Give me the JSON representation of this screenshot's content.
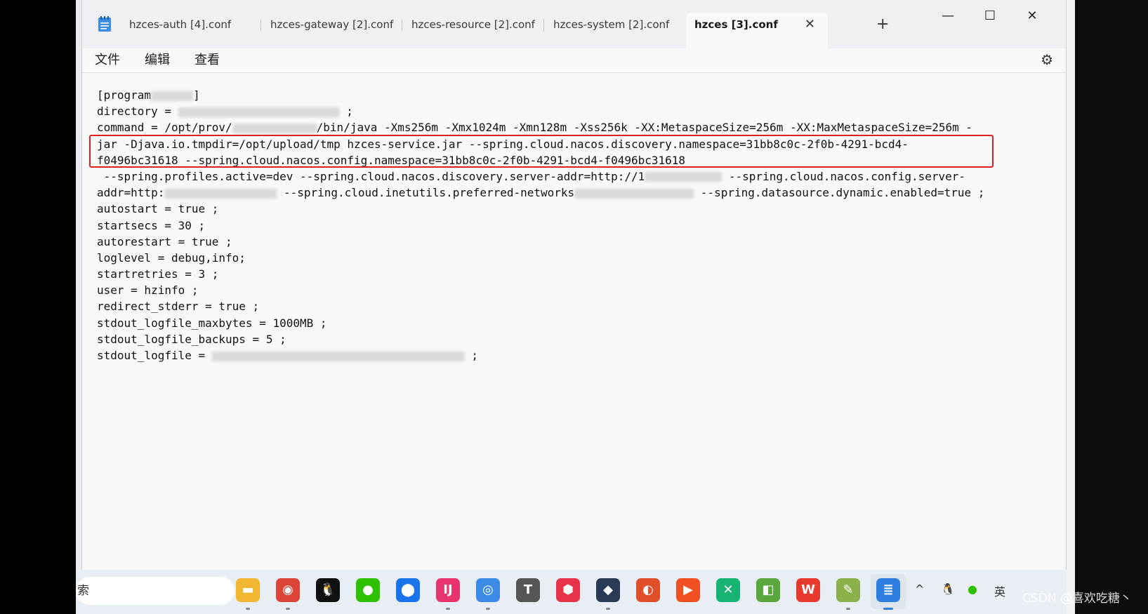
{
  "window": {
    "title_tabs": [
      {
        "label": "hzces-auth [4].conf",
        "active": false
      },
      {
        "label": "hzces-gateway [2].conf",
        "active": false
      },
      {
        "label": "hzces-resource [2].conf",
        "active": false
      },
      {
        "label": "hzces-system [2].conf",
        "active": false
      },
      {
        "label": "hzces [3].conf",
        "active": true
      }
    ],
    "close_tab_glyph": "✕",
    "new_tab_glyph": "+",
    "controls": {
      "minimize": "—",
      "maximize": "☐",
      "close": "✕"
    }
  },
  "menubar": {
    "file": "文件",
    "edit": "编辑",
    "view": "查看",
    "settings_glyph": "⚙"
  },
  "editor": {
    "lines": [
      {
        "pre": "[program",
        "blur": 60,
        "post": "]"
      },
      {
        "pre": "directory = ",
        "blur": 230,
        "post": " ;"
      },
      {
        "pre": "command = /opt/prov/",
        "blur": 120,
        "post": "/bin/java -Xms256m -Xmx1024m -Xmn128m -Xss256k -XX:MetaspaceSize=256m -XX:MaxMetaspaceSize=256m -"
      },
      {
        "pre": "jar -Djava.io.tmpdir=/opt/upload/tmp hzces-service.jar --spring.cloud.nacos.discovery.namespace=31bb8c0c-2f0b-4291-bcd4-",
        "blur": 0,
        "post": ""
      },
      {
        "pre": "f0496bc31618 --spring.cloud.nacos.config.namespace=31bb8c0c-2f0b-4291-bcd4-f0496bc31618",
        "blur": 0,
        "post": ""
      },
      {
        "pre": " --spring.profiles.active=dev --spring.cloud.nacos.discovery.server-addr=http://1",
        "blur": 110,
        "post": " --spring.cloud.nacos.config.server-"
      },
      {
        "pre": "addr=http:",
        "blur": 160,
        "post": " --spring.cloud.inetutils.preferred-networks",
        "blur2": 170,
        "post2": " --spring.datasource.dynamic.enabled=true ;"
      },
      {
        "pre": "autostart = true ;",
        "blur": 0,
        "post": ""
      },
      {
        "pre": "startsecs = 30 ;",
        "blur": 0,
        "post": ""
      },
      {
        "pre": "autorestart = true ;",
        "blur": 0,
        "post": ""
      },
      {
        "pre": "loglevel = debug,info;",
        "blur": 0,
        "post": ""
      },
      {
        "pre": "startretries = 3 ;",
        "blur": 0,
        "post": ""
      },
      {
        "pre": "user = hzinfo ;",
        "blur": 0,
        "post": ""
      },
      {
        "pre": "redirect_stderr = true ;",
        "blur": 0,
        "post": ""
      },
      {
        "pre": "stdout_logfile_maxbytes = 1000MB ;",
        "blur": 0,
        "post": ""
      },
      {
        "pre": "stdout_logfile_backups = 5 ;",
        "blur": 0,
        "post": ""
      },
      {
        "pre": "stdout_logfile = ",
        "blur": 360,
        "post": " ;"
      }
    ]
  },
  "taskbar": {
    "search_text": "索",
    "apps": [
      {
        "name": "file-explorer-icon",
        "glyph": "▬",
        "color": "#f2b632"
      },
      {
        "name": "chrome-icon",
        "glyph": "◉",
        "color": "#db4437"
      },
      {
        "name": "qq-icon",
        "glyph": "🐧",
        "color": "#111111"
      },
      {
        "name": "wechat-icon",
        "glyph": "●",
        "color": "#2dc100"
      },
      {
        "name": "maps-icon",
        "glyph": "⬤",
        "color": "#1a73e8"
      },
      {
        "name": "intellij-icon",
        "glyph": "IJ",
        "color": "#e8336d"
      },
      {
        "name": "browser-icon",
        "glyph": "◎",
        "color": "#3c8ce7"
      },
      {
        "name": "typora-icon",
        "glyph": "T",
        "color": "#555555"
      },
      {
        "name": "app-red-icon",
        "glyph": "⬢",
        "color": "#e6334a"
      },
      {
        "name": "cat-icon",
        "glyph": "◆",
        "color": "#2b3a55"
      },
      {
        "name": "shell-icon",
        "glyph": "◐",
        "color": "#e04e2a"
      },
      {
        "name": "player-icon",
        "glyph": "▶",
        "color": "#f25022"
      },
      {
        "name": "xmind-icon",
        "glyph": "✕",
        "color": "#16b373"
      },
      {
        "name": "app-green-icon",
        "glyph": "◧",
        "color": "#5aa83d"
      },
      {
        "name": "wps-icon",
        "glyph": "W",
        "color": "#e8392e"
      },
      {
        "name": "notepadpp-icon",
        "glyph": "✎",
        "color": "#8bb24a"
      },
      {
        "name": "notepad-icon",
        "glyph": "≣",
        "color": "#2f7fe0"
      }
    ],
    "tray": {
      "chevron": "^",
      "ime": "英"
    }
  },
  "watermark": "CSDN @喜欢吃糖丶"
}
